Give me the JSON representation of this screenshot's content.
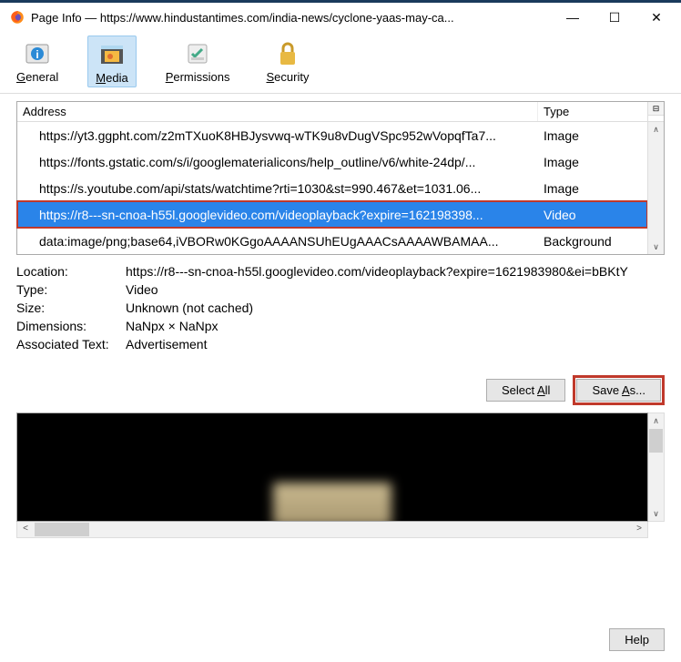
{
  "titlebar": {
    "title": "Page Info — https://www.hindustantimes.com/india-news/cyclone-yaas-may-ca..."
  },
  "tabs": {
    "general": "General",
    "media": "Media",
    "permissions": "Permissions",
    "security": "Security"
  },
  "list": {
    "header_address": "Address",
    "header_type": "Type",
    "rows": [
      {
        "address": "https://yt3.ggpht.com/z2mTXuoK8HBJysvwq-wTK9u8vDugVSpc952wVopqfTa7...",
        "type": "Image",
        "selected": false
      },
      {
        "address": "https://fonts.gstatic.com/s/i/googlematerialicons/help_outline/v6/white-24dp/...",
        "type": "Image",
        "selected": false
      },
      {
        "address": "https://s.youtube.com/api/stats/watchtime?rti=1030&st=990.467&et=1031.06...",
        "type": "Image",
        "selected": false
      },
      {
        "address": "https://r8---sn-cnoa-h55l.googlevideo.com/videoplayback?expire=162198398...",
        "type": "Video",
        "selected": true
      },
      {
        "address": "data:image/png;base64,iVBORw0KGgoAAAANSUhEUgAAACsAAAAWBAMAA...",
        "type": "Background",
        "selected": false
      }
    ]
  },
  "details": {
    "location_label": "Location:",
    "location_value": "https://r8---sn-cnoa-h55l.googlevideo.com/videoplayback?expire=1621983980&ei=bBKtY",
    "type_label": "Type:",
    "type_value": "Video",
    "size_label": "Size:",
    "size_value": "Unknown (not cached)",
    "dimensions_label": "Dimensions:",
    "dimensions_value": "NaNpx × NaNpx",
    "assoc_label": "Associated Text:",
    "assoc_value": "Advertisement"
  },
  "buttons": {
    "select_all": "Select All",
    "save_as": "Save As...",
    "help": "Help"
  }
}
